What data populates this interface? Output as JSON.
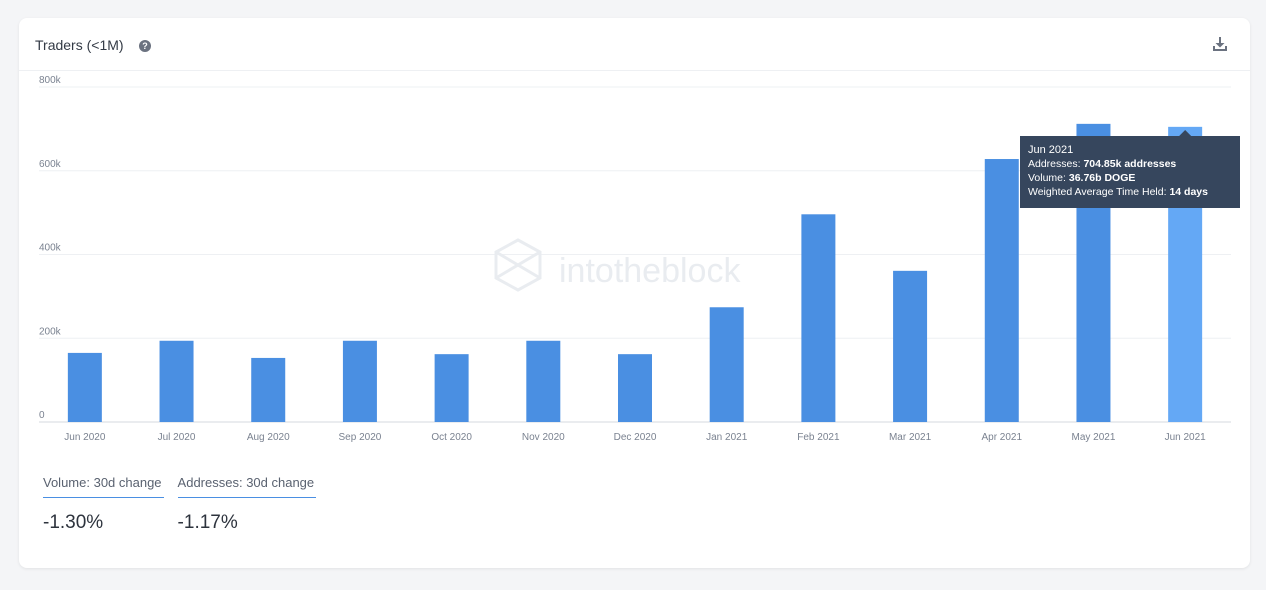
{
  "card": {
    "title": "Traders (<1M)",
    "help_icon": "question-circle-icon",
    "download_icon": "download-icon"
  },
  "watermark": "intotheblock",
  "colors": {
    "bar": "#4a8fe2",
    "bar_highlight": "#64a8f5",
    "tooltip_bg": "#36465d",
    "grid": "#eef0f3",
    "axis_text": "#7a8290"
  },
  "chart_data": {
    "type": "bar",
    "categories": [
      "Jun 2020",
      "Jul 2020",
      "Aug 2020",
      "Sep 2020",
      "Oct 2020",
      "Nov 2020",
      "Dec 2020",
      "Jan 2021",
      "Feb 2021",
      "Mar 2021",
      "Apr 2021",
      "May 2021",
      "Jun 2021"
    ],
    "values": [
      165000,
      194000,
      153000,
      194000,
      162000,
      194000,
      162000,
      274000,
      496000,
      361000,
      628000,
      712000,
      704850
    ],
    "ylim": [
      0,
      800000
    ],
    "yticks": [
      "0",
      "200k",
      "400k",
      "600k",
      "800k"
    ],
    "ytick_values": [
      0,
      200000,
      400000,
      600000,
      800000
    ],
    "highlight_index": 12,
    "grid": true,
    "tooltip": {
      "title": "Jun 2021",
      "rows": [
        {
          "label": "Addresses: ",
          "value": "704.85k addresses"
        },
        {
          "label": "Volume: ",
          "value": "36.76b DOGE"
        },
        {
          "label": "Weighted Average Time Held: ",
          "value": "14 days"
        }
      ]
    }
  },
  "stats": [
    {
      "label": "Volume: 30d change",
      "value": "-1.30%"
    },
    {
      "label": "Addresses: 30d change",
      "value": "-1.17%"
    }
  ]
}
